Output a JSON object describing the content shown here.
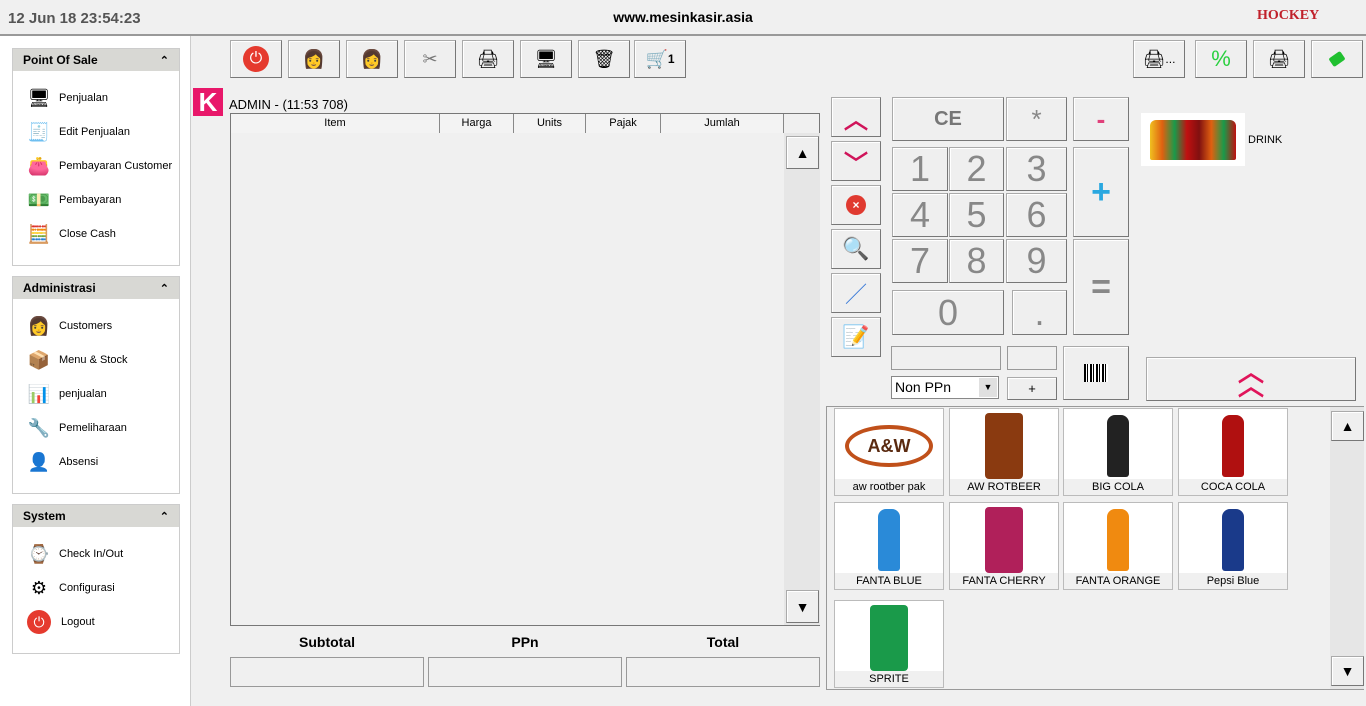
{
  "header": {
    "datetime": "12 Jun 18  23:54:23",
    "site": "www.mesinkasir.asia",
    "logo": "HOCKEY"
  },
  "sidebar": [
    {
      "title": "Point Of Sale",
      "items": [
        {
          "label": "Penjualan",
          "icon": "pos-terminal-icon"
        },
        {
          "label": "Edit Penjualan",
          "icon": "cash-register-icon"
        },
        {
          "label": "Pembayaran Customer",
          "icon": "wallet-icon"
        },
        {
          "label": "Pembayaran",
          "icon": "money-icon"
        },
        {
          "label": "Close Cash",
          "icon": "calculator-icon"
        }
      ]
    },
    {
      "title": "Administrasi",
      "items": [
        {
          "label": "Customers",
          "icon": "customer-icon"
        },
        {
          "label": "Menu & Stock",
          "icon": "barcode-stock-icon"
        },
        {
          "label": "penjualan",
          "icon": "sales-report-icon"
        },
        {
          "label": "Pemeliharaan",
          "icon": "maintenance-icon"
        },
        {
          "label": "Absensi",
          "icon": "attendance-icon"
        }
      ]
    },
    {
      "title": "System",
      "items": [
        {
          "label": "Check In/Out",
          "icon": "check-in-icon"
        },
        {
          "label": "Configurasi",
          "icon": "configuration-icon"
        },
        {
          "label": "Logout",
          "icon": "logout-icon"
        }
      ]
    }
  ],
  "toolbar": {
    "buttons": [
      "power-icon",
      "add-customer-icon",
      "customer-icon",
      "scissors-icon",
      "printer-icon",
      "pos-terminal-icon",
      "trash-icon",
      "cart-icon"
    ],
    "cart_count": "1",
    "right_buttons": [
      "printer-more-icon",
      "discount-icon",
      "printer-icon",
      "eraser-icon"
    ],
    "printer_more": "...",
    "percent": "%"
  },
  "ticket": {
    "user": "ADMIN - (11:53 708)",
    "columns": [
      "Item",
      "Harga",
      "Units",
      "Pajak",
      "Jumlah"
    ],
    "rows": []
  },
  "totals": {
    "subtotal_label": "Subtotal",
    "tax_label": "PPn",
    "total_label": "Total",
    "subtotal": "",
    "tax": "",
    "total": ""
  },
  "numpad": {
    "keys": [
      "1",
      "2",
      "3",
      "4",
      "5",
      "6",
      "7",
      "8",
      "9"
    ],
    "zero": "0",
    "dot": ".",
    "ce": "CE",
    "multiply": "*",
    "minus": "-",
    "plus": "+",
    "equals": "=",
    "add": "+"
  },
  "tax_select": {
    "value": "Non PPn"
  },
  "category": {
    "label": "DRINK"
  },
  "products": [
    {
      "name": "aw rootber pak",
      "color": "#c0501a"
    },
    {
      "name": "AW ROTBEER",
      "color": "#8a3a10"
    },
    {
      "name": "BIG COLA",
      "color": "#222222"
    },
    {
      "name": "COCA COLA",
      "color": "#b01010"
    },
    {
      "name": "FANTA BLUE",
      "color": "#2a8ad8"
    },
    {
      "name": "FANTA CHERRY",
      "color": "#b0205a"
    },
    {
      "name": "FANTA ORANGE",
      "color": "#f08a10"
    },
    {
      "name": "Pepsi Blue",
      "color": "#1a3a8a"
    },
    {
      "name": "SPRITE",
      "color": "#1a9a4a"
    }
  ]
}
